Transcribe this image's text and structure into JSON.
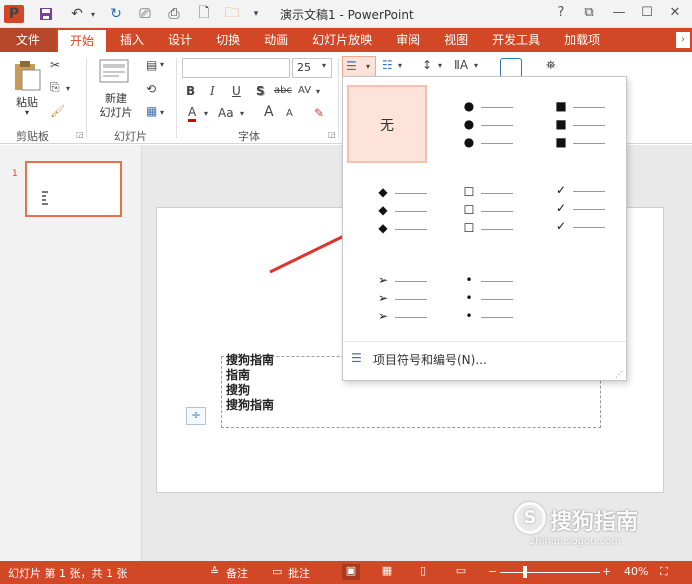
{
  "titlebar": {
    "app_logo": "P",
    "title": "演示文稿1 - PowerPoint",
    "buttons": {
      "help": "?",
      "restore_ribbon": "⧉",
      "minimize": "—",
      "maximize": "☐",
      "close": "✕"
    }
  },
  "tabs": [
    "文件",
    "开始",
    "插入",
    "设计",
    "切换",
    "动画",
    "幻灯片放映",
    "审阅",
    "视图",
    "开发工具",
    "加载项"
  ],
  "active_tab": "开始",
  "ribbon": {
    "groups": {
      "clipboard": "剪贴板",
      "slides": "幻灯片",
      "font": "字体"
    },
    "paste_label": "粘贴",
    "new_slide_label_1": "新建",
    "new_slide_label_2": "幻灯片",
    "font_name": "",
    "font_size": "25",
    "font_buttons": {
      "bold": "B",
      "italic": "I",
      "underline": "U",
      "shadow": "S",
      "strike": "abc",
      "spacing": "AV",
      "color": "A",
      "case": "Aa",
      "grow": "A",
      "shrink": "A",
      "clear": "✎"
    }
  },
  "slide_panel": {
    "slide_number": "1"
  },
  "slide": {
    "text_lines": [
      "搜狗指南",
      "指南",
      "搜狗",
      "搜狗指南"
    ]
  },
  "gallery": {
    "none_label": "无",
    "styles": [
      {
        "name": "none",
        "glyph": ""
      },
      {
        "name": "filled-round",
        "glyph": "●"
      },
      {
        "name": "filled-square",
        "glyph": "■"
      },
      {
        "name": "diamond",
        "glyph": "◆"
      },
      {
        "name": "hollow-square",
        "glyph": "☐"
      },
      {
        "name": "checkmark",
        "glyph": "✓"
      },
      {
        "name": "arrowhead",
        "glyph": "➢"
      },
      {
        "name": "small-dot",
        "glyph": "•"
      }
    ],
    "footer_link": "项目符号和编号(N)...",
    "footer_icon": "list-icon"
  },
  "statusbar": {
    "slide_info": "幻灯片 第 1 张，共 1 张",
    "notes": "备注",
    "comments": "批注",
    "zoom": "40%",
    "zoom_level": 0.4
  },
  "watermark": {
    "logo": "S",
    "text": "搜狗指南",
    "sub": "zhinan.sogou.com"
  }
}
